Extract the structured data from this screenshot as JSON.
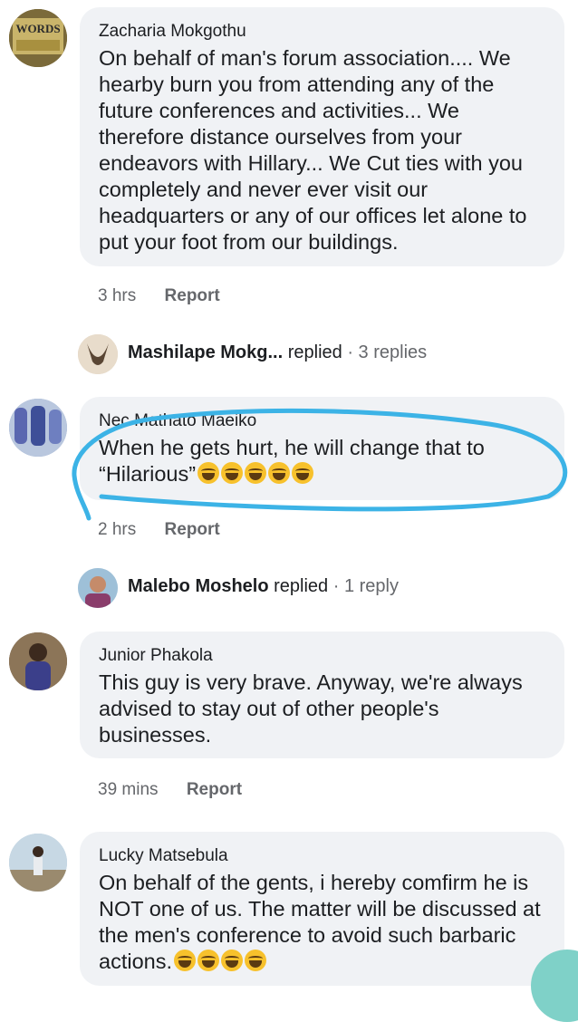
{
  "comments": [
    {
      "author": "Zacharia Mokgothu",
      "avatar_label": "WORDS",
      "text": "On behalf of man's forum association.... We hearby burn you from attending any of the future conferences and activities... We therefore distance ourselves from your endeavors with Hillary... We Cut ties with you completely and never ever visit our headquarters or any of our offices let alone to put your foot from our buildings.",
      "time": "3 hrs",
      "report": "Report"
    },
    {
      "author": "Nec Mathato Maeiko",
      "text": "When he gets hurt, he will change that to “Hilarious”",
      "emoji_count": 5,
      "time": "2 hrs",
      "report": "Report"
    },
    {
      "author": "Junior Phakola",
      "text": "This guy is very brave. Anyway, we're always advised to stay out of other people's businesses.",
      "time": "39 mins",
      "report": "Report"
    },
    {
      "author": "Lucky Matsebula",
      "text": "On behalf of the gents, i hereby comfirm he is NOT one of us. The matter will be discussed at the men's conference to avoid such barbaric actions.",
      "emoji_count": 4,
      "time": "",
      "report": ""
    }
  ],
  "replies": [
    {
      "name": "Mashilape Mokg...",
      "verb": "replied",
      "count": "3 replies"
    },
    {
      "name": "Malebo Moshelo",
      "verb": "replied",
      "count": "1 reply"
    }
  ],
  "colors": {
    "bubble": "#f0f2f5",
    "meta_text": "#65676b",
    "annotation_stroke": "#3cb3e6"
  }
}
